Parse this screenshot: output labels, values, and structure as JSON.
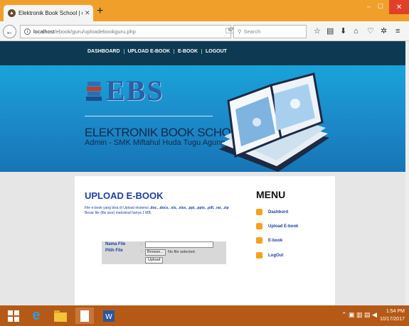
{
  "browser": {
    "tab_title": "Elektronik Book School | e-Bo",
    "tab_close": "✕",
    "new_tab": "+",
    "url_host": "localhost",
    "url_path": "/ebook/guru/uploadebookguru.php",
    "zoom": "67%",
    "search_placeholder": "Search",
    "window_controls": [
      "–",
      "☐",
      "✕"
    ]
  },
  "site_nav": {
    "items": [
      "DASHBOARD",
      "UPLOAD E-BOOK",
      "E-BOOK",
      "LOGOUT"
    ]
  },
  "banner": {
    "logo_text": "EBS",
    "title": "ELEKTRONIK BOOK SCHOOL",
    "subtitle": "Admin - SMK Miftahul Huda Tugu Agung"
  },
  "upload": {
    "heading": "UPLOAD E-BOOK",
    "desc_prefix": "File e-book yang bisa di Upload ekstensi ",
    "extensions": ".doc, .docx, .xls, .xlsx, .ppt, .pptx, .pdf, .rar, .zip",
    "size_note": "Besar file (file size) maksimal hanya 1 MB.",
    "label_name": "Nama File",
    "label_file": "Pilih File",
    "colon": ":",
    "browse_label": "Browse...",
    "no_file": "No file selected.",
    "upload_label": "Upload"
  },
  "menu": {
    "heading": "MENU",
    "items": [
      "Dashbord",
      "Upload E-book",
      "E-book",
      "LogOut"
    ]
  },
  "taskbar": {
    "time": "1:54 PM",
    "date": "10/17/2017"
  },
  "colors": {
    "tab_bar": "#f0a02a",
    "site_nav": "#0d3a52",
    "banner": "#1b86c6",
    "heading_blue": "#1c3fa0",
    "menu_bullet": "#f5a21b",
    "taskbar": "#b55a16"
  },
  "icons": [
    "firefox-icon",
    "info-icon",
    "reload-icon",
    "star-icon",
    "reading-list-icon",
    "download-icon",
    "home-icon",
    "pocket-icon",
    "puzzle-icon",
    "hamburger-icon",
    "windows-start-icon",
    "ie-icon",
    "file-explorer-icon",
    "document-icon",
    "word-icon"
  ]
}
